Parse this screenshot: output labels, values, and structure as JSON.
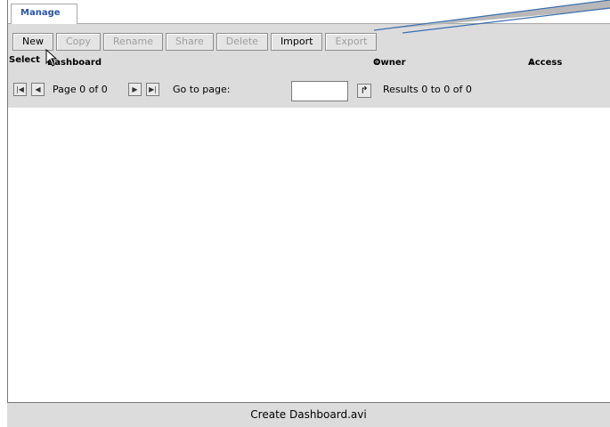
{
  "tabs": [
    {
      "label": "Manage"
    }
  ],
  "toolbar": {
    "buttons": [
      {
        "label": "New",
        "enabled": true
      },
      {
        "label": "Copy",
        "enabled": false
      },
      {
        "label": "Rename",
        "enabled": false
      },
      {
        "label": "Share",
        "enabled": false
      },
      {
        "label": "Delete",
        "enabled": false
      },
      {
        "label": "Import",
        "enabled": true
      },
      {
        "label": "Export",
        "enabled": false
      }
    ]
  },
  "table": {
    "columns": [
      "Select",
      "Dashboard",
      "Owner",
      "Access"
    ],
    "sort_icon": "⇕"
  },
  "pager": {
    "page_text": "Page 0 of 0",
    "goto_label": "Go to page:",
    "goto_value": "",
    "results_text": "Results 0 to 0 of 0"
  },
  "footer": {
    "caption": "Create Dashboard.avi"
  },
  "icons": {
    "first": "first-page-icon",
    "prev": "prev-page-icon",
    "next": "next-page-icon",
    "last": "last-page-icon",
    "go": "go-arrow-icon",
    "cursor": "mouse-cursor-icon"
  },
  "colors": {
    "tab_text": "#2a57a5",
    "toolbar_bg": "#dcdcdc",
    "callout": "#3a6fb0"
  }
}
